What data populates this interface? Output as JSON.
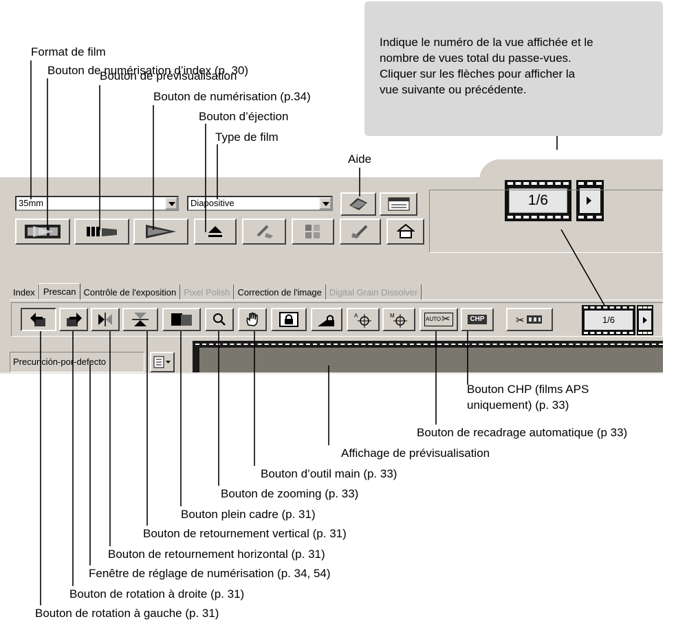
{
  "callout": {
    "text": "Indique le numéro de la vue affichée et le\nnombre de vues total du passe-vues.\nCliquer sur les flèches pour afficher la\nvue suivante ou précédente."
  },
  "labels_top": {
    "format_de_film": "Format de film",
    "index_scan": "Bouton de numérisation d’index (p. 30)",
    "prescan": "Bouton de prévisualisation",
    "scan": "Bouton de numérisation (p.34)",
    "eject": "Bouton d’éjection",
    "film_type": "Type de film",
    "help": "Aide"
  },
  "app": {
    "film_format_value": "35mm",
    "film_type_value": "Diapositive",
    "frame_counter": "1/6",
    "tabs": [
      {
        "label": "Index",
        "state": "normal"
      },
      {
        "label": "Prescan",
        "state": "active"
      },
      {
        "label": "Contrôle de l'exposition",
        "state": "normal"
      },
      {
        "label": "Pixel Polish",
        "state": "disabled"
      },
      {
        "label": "Correction de l'image",
        "state": "normal"
      },
      {
        "label": "Digital Grain Dissolver",
        "state": "disabled"
      }
    ],
    "scan_setting_value": "Precunción-por-defecto",
    "tool_icons": {
      "auto_crop": "AUTO",
      "chp": "CHP"
    }
  },
  "labels_bottom": {
    "chp": "Bouton CHP (films APS\nuniquement) (p. 33)",
    "auto_crop": "Bouton de recadrage automatique (p 33)",
    "preview_display": "Affichage de prévisualisation",
    "hand_tool": "Bouton d’outil main (p. 33)",
    "zoom": "Bouton de zooming (p. 33)",
    "full_frame": "Bouton plein cadre (p. 31)",
    "flip_vertical": "Bouton de retournement vertical  (p. 31)",
    "flip_horizontal": "Bouton de retournement horizontal (p. 31)",
    "scan_settings_window": "Fenêtre de réglage de numérisation (p. 34, 54)",
    "rotate_right": "Bouton de rotation à droite (p. 31)",
    "rotate_left": "Bouton de rotation à gauche (p. 31)"
  },
  "colors": {
    "window_bg": "#d4d0c8",
    "callout_bg": "#d9d9d9",
    "disabled_text": "#9a9a9a"
  }
}
